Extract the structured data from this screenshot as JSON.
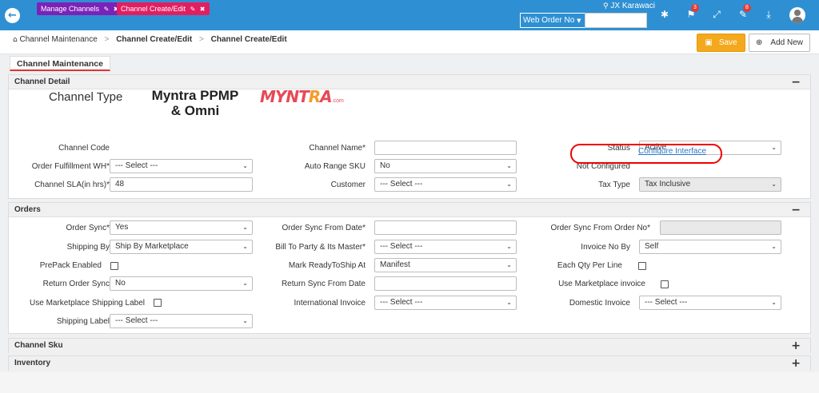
{
  "topbar": {
    "tabs": [
      {
        "label": "Manage Channels",
        "pin": "✎",
        "close": "✖"
      },
      {
        "label": "Channel Create/Edit",
        "pin": "✎",
        "close": "✖"
      }
    ],
    "location": "JX Karawaci",
    "search_scope": "Web Order No",
    "search_value": "",
    "badges": {
      "flag": "3",
      "tools": "8"
    },
    "icons": [
      "back-arrow-icon",
      "gear-icon",
      "flag-icon",
      "expand-icon",
      "tools-icon",
      "download-icon",
      "user-avatar-icon"
    ]
  },
  "breadcrumb": {
    "home": "Channel Maintenance",
    "items": [
      "Channel Create/Edit",
      "Channel Create/Edit"
    ]
  },
  "actions": {
    "save": "Save",
    "add_new": "Add New"
  },
  "page_tab": "Channel Maintenance",
  "channel_detail": {
    "title": "Channel Detail",
    "toggle": "−",
    "channel_type_label": "Channel Type",
    "channel_type_line1": "Myntra PPMP",
    "channel_type_line2": "& Omni",
    "logo_text_1": "MYNT",
    "logo_text_2": "R",
    "logo_text_3": "A",
    "logo_suffix": ".com",
    "fields": {
      "channel_code": {
        "label": "Channel Code",
        "value": ""
      },
      "channel_name": {
        "label": "Channel Name*",
        "value": ""
      },
      "status": {
        "label": "Status",
        "value": "Active"
      },
      "order_fulfillment_wh": {
        "label": "Order Fulfillment WH*",
        "value": "--- Select ---"
      },
      "auto_range_sku": {
        "label": "Auto Range SKU",
        "value": "No"
      },
      "interface_status": {
        "label": "Not Configured",
        "link": "Configure Interface"
      },
      "channel_sla": {
        "label": "Channel SLA(in hrs)*",
        "value": "48"
      },
      "customer": {
        "label": "Customer",
        "value": "--- Select ---"
      },
      "tax_type": {
        "label": "Tax Type",
        "value": "Tax Inclusive"
      }
    }
  },
  "orders": {
    "title": "Orders",
    "toggle": "−",
    "fields": {
      "order_sync": {
        "label": "Order Sync*",
        "value": "Yes"
      },
      "order_sync_from_date": {
        "label": "Order Sync From Date*",
        "value": ""
      },
      "order_sync_from_order_no": {
        "label": "Order Sync From Order No*",
        "value": ""
      },
      "shipping_by": {
        "label": "Shipping By",
        "value": "Ship By Marketplace"
      },
      "bill_to_party": {
        "label": "Bill To Party & Its Master*",
        "value": "--- Select ---"
      },
      "invoice_no_by": {
        "label": "Invoice No By",
        "value": "Self"
      },
      "prepack_enabled": {
        "label": "PrePack Enabled"
      },
      "mark_ready_to_ship": {
        "label": "Mark ReadyToShip At",
        "value": "Manifest"
      },
      "each_qty_per_line": {
        "label": "Each Qty Per Line"
      },
      "return_order_sync": {
        "label": "Return Order Sync",
        "value": "No"
      },
      "return_sync_from_date": {
        "label": "Return Sync From Date",
        "value": ""
      },
      "use_marketplace_invoice": {
        "label": "Use Marketplace invoice"
      },
      "use_marketplace_shipping_label": {
        "label": "Use Marketplace Shipping Label"
      },
      "international_invoice": {
        "label": "International Invoice",
        "value": "--- Select ---"
      },
      "domestic_invoice": {
        "label": "Domestic Invoice",
        "value": "--- Select ---"
      },
      "shipping_label": {
        "label": "Shipping Label",
        "value": "--- Select ---"
      }
    }
  },
  "channel_sku": {
    "title": "Channel Sku",
    "toggle": "+"
  },
  "inventory": {
    "title": "Inventory",
    "toggle": "+"
  },
  "colors": {
    "topbar": "#2e90d3",
    "save": "#f4a81c",
    "highlight_ring": "#e00000",
    "link": "#2a75c7"
  }
}
